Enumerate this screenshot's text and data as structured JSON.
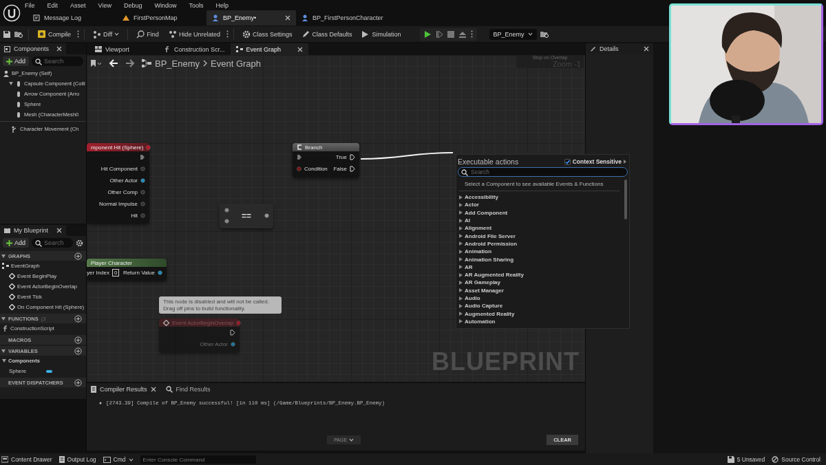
{
  "menu": [
    "File",
    "Edit",
    "Asset",
    "View",
    "Debug",
    "Window",
    "Tools",
    "Help"
  ],
  "doc_tabs": [
    {
      "label": "Message Log",
      "selected": false
    },
    {
      "label": "FirstPersonMap",
      "selected": false
    },
    {
      "label": "BP_Enemy•",
      "selected": true
    },
    {
      "label": "BP_FirstPersonCharacter",
      "selected": false
    }
  ],
  "toolbar": {
    "compile": "Compile",
    "diff": "Diff",
    "find": "Find",
    "hide_unrelated": "Hide Unrelated",
    "class_settings": "Class Settings",
    "class_defaults": "Class Defaults",
    "simulation": "Simulation",
    "debug_object": "BP_Enemy"
  },
  "components_panel": {
    "title": "Components",
    "add": "Add",
    "search_placeholder": "Search",
    "tree": [
      {
        "label": "BP_Enemy (Self)",
        "children": [
          {
            "label": "Capsule Component (Colli",
            "expanded": true,
            "children": [
              {
                "label": "Arrow Component (Arro"
              },
              {
                "label": "Sphere"
              },
              {
                "label": "Mesh (CharacterMesh0"
              }
            ]
          }
        ]
      }
    ],
    "movement": [
      {
        "label": "Character Movement (Ch"
      }
    ]
  },
  "editor_tabs": [
    {
      "label": "Viewport",
      "selected": false
    },
    {
      "label": "Construction Scr...",
      "selected": false
    },
    {
      "label": "Event Graph",
      "selected": true
    }
  ],
  "breadcrumb": [
    "BP_Enemy",
    "Event Graph"
  ],
  "graph": {
    "debug_hint": "Stop on Overlap",
    "zoom": "Zoom -1",
    "watermark": "BLUEPRINT",
    "nodes": [
      {
        "kind": "event",
        "title": "mponent Hit (Sphere)",
        "outputs": [
          "Hit Component",
          "Other Actor",
          "Other Comp",
          "Normal Impulse",
          "Hit"
        ]
      },
      {
        "kind": "branch",
        "title": "Branch",
        "inputs": [
          "Condition"
        ],
        "outputs": [
          "True",
          "False"
        ]
      },
      {
        "kind": "operator",
        "title": "=="
      },
      {
        "kind": "pure",
        "title": "Player Character",
        "inputs": [
          "yer Index"
        ],
        "input_value": "0",
        "outputs": [
          "Return Value"
        ]
      },
      {
        "kind": "disabled",
        "title": "Event ActorBeginOverlap",
        "outputs": [
          "Other Actor"
        ],
        "comment": "This node is disabled and will not be called.\nDrag off pins to build functionality."
      }
    ]
  },
  "action_menu": {
    "title": "Executable actions",
    "context_sensitive": {
      "label": "Context Sensitive",
      "checked": true
    },
    "search_placeholder": "Search",
    "hint": "Select a Component to see available Events & Functions",
    "categories": [
      "Accessibility",
      "Actor",
      "Add Component",
      "AI",
      "Alignment",
      "Android File Server",
      "Android Permission",
      "Animation",
      "Animation Sharing",
      "AR",
      "AR Augmented Reality",
      "AR Gameplay",
      "Asset Manager",
      "Audio",
      "Audio Capture",
      "Augmented Reality",
      "Automation"
    ]
  },
  "details": {
    "title": "Details"
  },
  "my_blueprint": {
    "title": "My Blueprint",
    "add": "Add",
    "search_placeholder": "Search",
    "sections": [
      {
        "label": "GRAPHS",
        "expanded": true,
        "items": [
          {
            "kind": "graph",
            "label": "EventGraph",
            "children": [
              {
                "kind": "event",
                "label": "Event BeginPlay"
              },
              {
                "kind": "event",
                "label": "Event ActorBeginOverlap"
              },
              {
                "kind": "event",
                "label": "Event Tick"
              },
              {
                "kind": "event",
                "label": "On Component Hit (Sphere)"
              }
            ]
          }
        ]
      },
      {
        "label": "FUNCTIONS",
        "count": "(3",
        "expanded": true,
        "items": [
          {
            "kind": "function",
            "label": "ConstructionScript"
          }
        ]
      },
      {
        "label": "MACROS"
      },
      {
        "label": "VARIABLES",
        "expanded": true,
        "items": [
          {
            "kind": "category",
            "label": "Components",
            "children": [
              {
                "kind": "variable",
                "label": "Sphere"
              }
            ]
          }
        ]
      },
      {
        "label": "EVENT DISPATCHERS"
      }
    ]
  },
  "compiler": {
    "tabs": [
      {
        "label": "Compiler Results",
        "selected": true
      },
      {
        "label": "Find Results",
        "selected": false
      }
    ],
    "messages": [
      "[2743.39] Compile of BP_Enemy successful! [in 110 ms] (/Game/Blueprints/BP_Enemy.BP_Enemy)"
    ],
    "page": "PAGE",
    "clear": "CLEAR"
  },
  "status_bar": {
    "content_drawer": "Content Drawer",
    "output_log": "Output Log",
    "cmd": "Cmd",
    "console_placeholder": "Enter Console Command",
    "unsaved": "5 Unsaved",
    "source_control": "Source Control"
  },
  "webcam": {
    "kind": "picture"
  }
}
